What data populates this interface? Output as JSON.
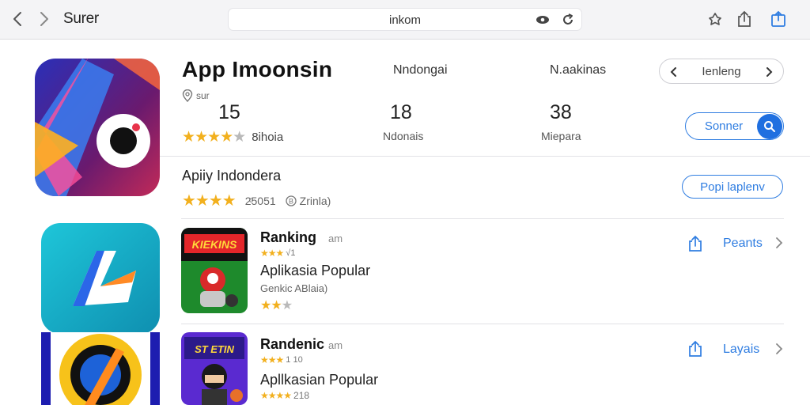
{
  "toolbar": {
    "app_name": "Surer",
    "url": "inkom",
    "back_icon": "chevron-left-icon",
    "forward_icon": "chevron-right-icon",
    "reader_icon": "eye-icon",
    "reload_icon": "reload-icon",
    "tools": [
      "bookmark-icon",
      "share-icon",
      "tabs-icon"
    ]
  },
  "header": {
    "title": "App  Imoonsin",
    "location": "ѕur",
    "columns": [
      "Nndongai",
      "N.aakinas"
    ],
    "stats": [
      {
        "value": "15",
        "label": ""
      },
      {
        "value": "18",
        "label": "Ndonais"
      },
      {
        "value": "38",
        "label": "Miepara"
      }
    ],
    "rating_stars": 4,
    "rating_text": "8ihoia",
    "pager_label": "Ienleng",
    "search_label": "Sonner"
  },
  "section": {
    "title": "Apiiy Indondera",
    "stars": 4,
    "count_text": "2ͦ5051",
    "meta_text": "Zrinla)",
    "button_label": "Popi laplenv"
  },
  "rows": [
    {
      "name": "Ranking",
      "tag": "am",
      "mini_stars": 3,
      "mini_text": "√1",
      "category": "Aplikasia Popular",
      "sub": "Genkic ABlaia)",
      "stars": 2,
      "thumb_text": "KIEKINS",
      "action": "Peants"
    },
    {
      "name": "Randenic",
      "tag": "am",
      "mini_stars": 3,
      "mini_text": "1 10",
      "category": "Apllkasian Popular",
      "sub": "",
      "stars": 4,
      "stars_text": "218",
      "thumb_text": "ST ETIN",
      "action": "Layais"
    }
  ],
  "colors": {
    "accent": "#2f7de1",
    "star": "#f2b01e",
    "toolbar_bg": "#f4f4f6"
  }
}
